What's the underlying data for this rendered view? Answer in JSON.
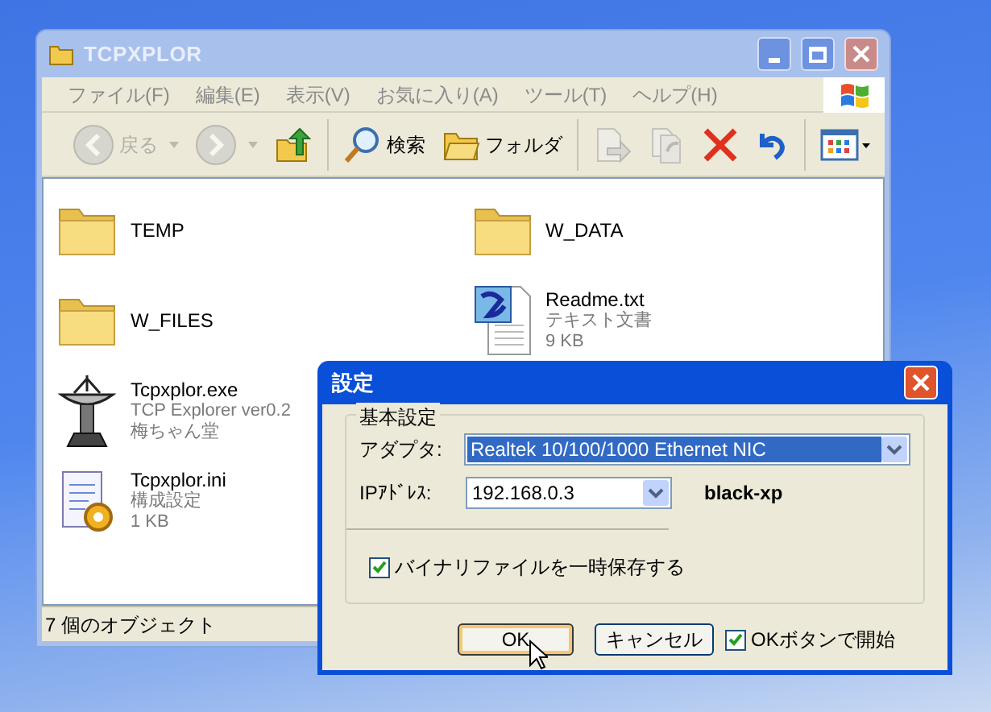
{
  "explorer": {
    "title": "TCPXPLOR",
    "menu": [
      "ファイル(F)",
      "編集(E)",
      "表示(V)",
      "お気に入り(A)",
      "ツール(T)",
      "ヘルプ(H)"
    ],
    "toolbar": [
      {
        "kind": "back",
        "label": "戻る",
        "disabled": true
      },
      {
        "kind": "forward",
        "disabled": true
      },
      {
        "kind": "up",
        "disabled": false
      },
      {
        "kind": "search",
        "label": "検索",
        "disabled": false
      },
      {
        "kind": "folders",
        "label": "フォルダ",
        "disabled": false
      },
      {
        "kind": "move",
        "disabled": true
      },
      {
        "kind": "copy",
        "disabled": true
      },
      {
        "kind": "delete",
        "disabled": false
      },
      {
        "kind": "undo",
        "disabled": false
      },
      {
        "kind": "views",
        "disabled": false
      }
    ],
    "items": [
      {
        "kind": "folder",
        "name": "TEMP"
      },
      {
        "kind": "folder",
        "name": "W_FILES"
      },
      {
        "kind": "exe",
        "name": "Tcpxplor.exe",
        "details": [
          "TCP Explorer ver0.2",
          "梅ちゃん堂"
        ]
      },
      {
        "kind": "ini",
        "name": "Tcpxplor.ini",
        "details": [
          "構成設定",
          "1 KB"
        ]
      },
      {
        "kind": "folder",
        "name": "W_DATA"
      },
      {
        "kind": "text",
        "name": "Readme.txt",
        "details": [
          "テキスト文書",
          "9 KB"
        ]
      }
    ],
    "status_bar": "7 個のオブジェクト"
  },
  "dialog": {
    "title": "設定",
    "group": "基本設定",
    "adapter": {
      "label": "アダプタ:",
      "value": "Realtek 10/100/1000 Ethernet NIC",
      "highlighted": true
    },
    "ip": {
      "label": "IPｱﾄﾞﾚｽ:",
      "value": "192.168.0.3",
      "highlighted": false
    },
    "host": "black-xp",
    "temp_save": {
      "label": "バイナリファイルを一時保存する",
      "checked": true
    },
    "buttons": [
      {
        "label": "OK",
        "default": true
      },
      {
        "label": "キャンセル",
        "default": false
      }
    ],
    "start_on_ok": {
      "label": "OKボタンで開始",
      "checked": true
    }
  }
}
